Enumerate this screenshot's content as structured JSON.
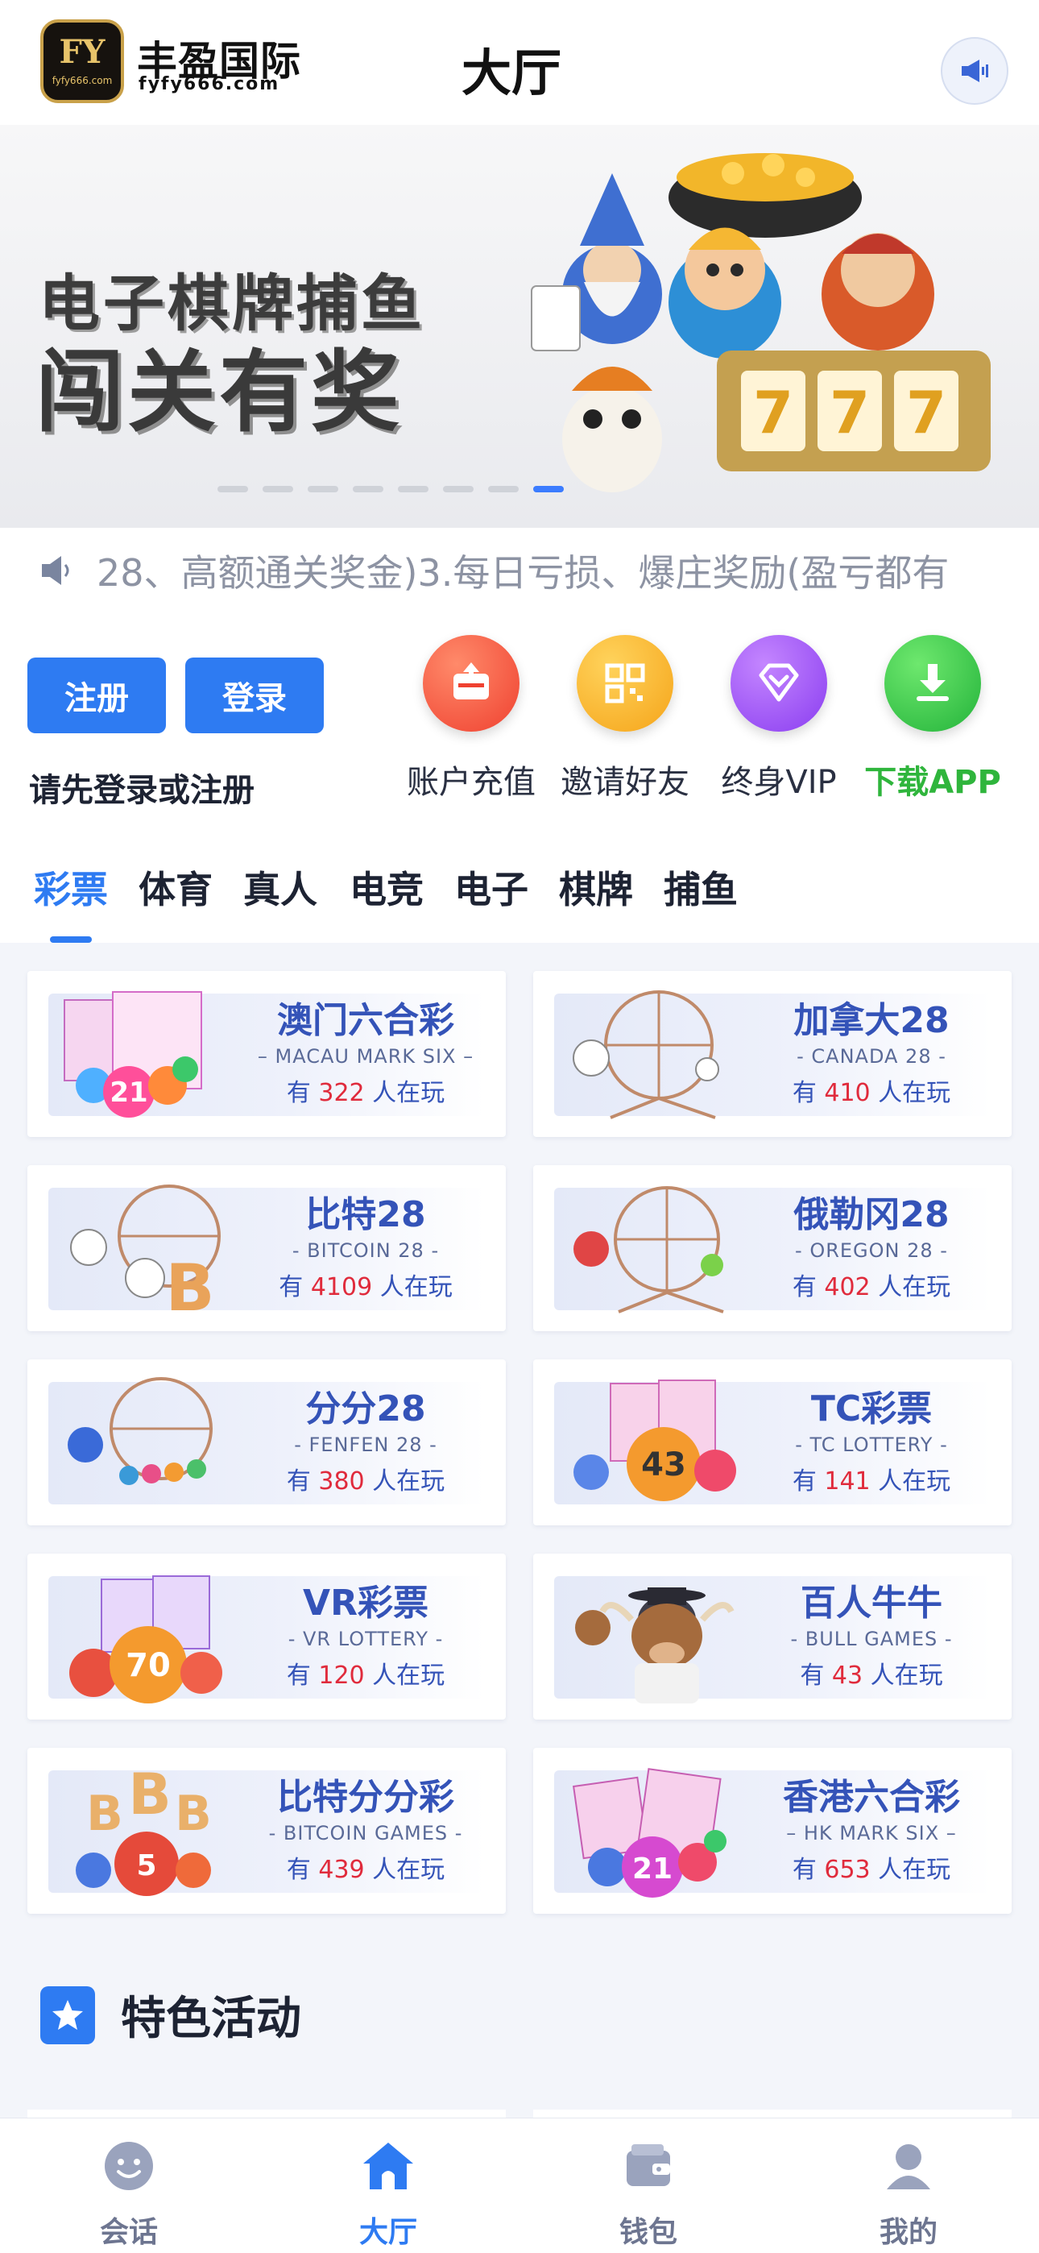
{
  "header": {
    "logo_text": "FY",
    "logo_domain": "fyfy666.com",
    "brand_name": "丰盈国际",
    "brand_domain": "fyfy666.com",
    "title": "大厅"
  },
  "banner": {
    "line1": "电子棋牌捕鱼",
    "line2": "闯关有奖",
    "slide_count": 8,
    "active_slide": 8
  },
  "notice": {
    "text": "28、高额通关奖金)3.每日亏损、爆庄奖励(盈亏都有"
  },
  "account": {
    "register_label": "注册",
    "login_label": "登录",
    "hint": "请先登录或注册"
  },
  "quick_actions": [
    {
      "label": "账户充值",
      "icon": "deposit-icon"
    },
    {
      "label": "邀请好友",
      "icon": "qr-code-icon"
    },
    {
      "label": "终身VIP",
      "icon": "diamond-icon"
    },
    {
      "label": "下载APP",
      "icon": "download-icon"
    }
  ],
  "tabs": [
    "彩票",
    "体育",
    "真人",
    "电竞",
    "电子",
    "棋牌",
    "捕鱼"
  ],
  "active_tab": "彩票",
  "games": [
    {
      "name": "澳门六合彩",
      "en": "– MACAU MARK SIX –",
      "play_prefix": "有 ",
      "count": "322",
      "play_suffix": " 人在玩"
    },
    {
      "name": "加拿大28",
      "en": "- CANADA 28 -",
      "play_prefix": "有 ",
      "count": "410",
      "play_suffix": " 人在玩"
    },
    {
      "name": "比特28",
      "en": "- BITCOIN 28 -",
      "play_prefix": "有 ",
      "count": "4109",
      "play_suffix": " 人在玩"
    },
    {
      "name": "俄勒冈28",
      "en": "- OREGON 28 -",
      "play_prefix": "有 ",
      "count": "402",
      "play_suffix": " 人在玩"
    },
    {
      "name": "分分28",
      "en": "- FENFEN 28 -",
      "play_prefix": "有 ",
      "count": "380",
      "play_suffix": " 人在玩"
    },
    {
      "name": "TC彩票",
      "en": "- TC LOTTERY -",
      "play_prefix": "有 ",
      "count": "141",
      "play_suffix": " 人在玩"
    },
    {
      "name": "VR彩票",
      "en": "- VR LOTTERY -",
      "play_prefix": "有 ",
      "count": "120",
      "play_suffix": " 人在玩"
    },
    {
      "name": "百人牛牛",
      "en": "- BULL GAMES -",
      "play_prefix": "有 ",
      "count": "43",
      "play_suffix": " 人在玩"
    },
    {
      "name": "比特分分彩",
      "en": "- BITCOIN GAMES -",
      "play_prefix": "有 ",
      "count": "439",
      "play_suffix": " 人在玩"
    },
    {
      "name": "香港六合彩",
      "en": "– HK MARK SIX –",
      "play_prefix": "有 ",
      "count": "653",
      "play_suffix": " 人在玩"
    }
  ],
  "section": {
    "title": "特色活动"
  },
  "bottom_nav": [
    {
      "label": "会话",
      "icon": "chat-icon"
    },
    {
      "label": "大厅",
      "icon": "home-icon"
    },
    {
      "label": "钱包",
      "icon": "wallet-icon"
    },
    {
      "label": "我的",
      "icon": "profile-icon"
    }
  ],
  "active_nav": "大厅",
  "colors": {
    "accent": "#2e7bf2",
    "count_red": "#e02b3c",
    "game_title": "#3453b8",
    "download_green": "#2fb53c"
  }
}
